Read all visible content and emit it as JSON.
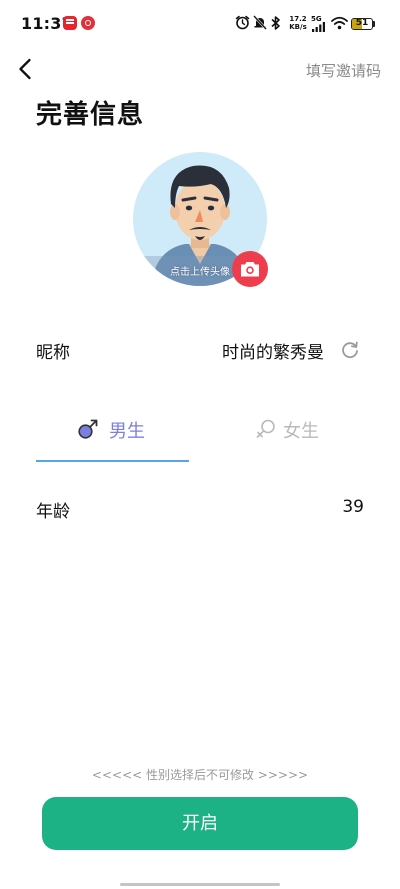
{
  "status_bar": {
    "time": "11:37",
    "net_speed_value": "17.2",
    "net_speed_unit": "KB/s",
    "network_type": "5G",
    "battery_level": "51",
    "battery_fraction": 0.51,
    "icons": [
      "app-notification-icon",
      "music-app-icon",
      "alarm-icon",
      "mute-icon",
      "bluetooth-icon",
      "signal-icon",
      "wifi-icon",
      "battery-icon"
    ]
  },
  "header": {
    "back_icon": "chevron-left-icon",
    "invite_label": "填写邀请码",
    "title": "完善信息"
  },
  "avatar": {
    "caption": "点击上传头像",
    "camera_icon": "camera-icon",
    "camera_button_color": "#ee3e4e"
  },
  "nickname": {
    "label": "昵称",
    "value": "时尚的繁秀曼",
    "refresh_icon": "refresh-icon"
  },
  "gender": {
    "male_label": "男生",
    "female_label": "女生",
    "selected": "male",
    "selected_color": "#7b7fe0",
    "underline_color": "#55a7ea"
  },
  "age": {
    "label": "年龄",
    "value": "39"
  },
  "footer": {
    "note": "<<<<< 性别选择后不可修改 >>>>>",
    "start_button_label": "开启",
    "start_button_color": "#1cb285"
  }
}
